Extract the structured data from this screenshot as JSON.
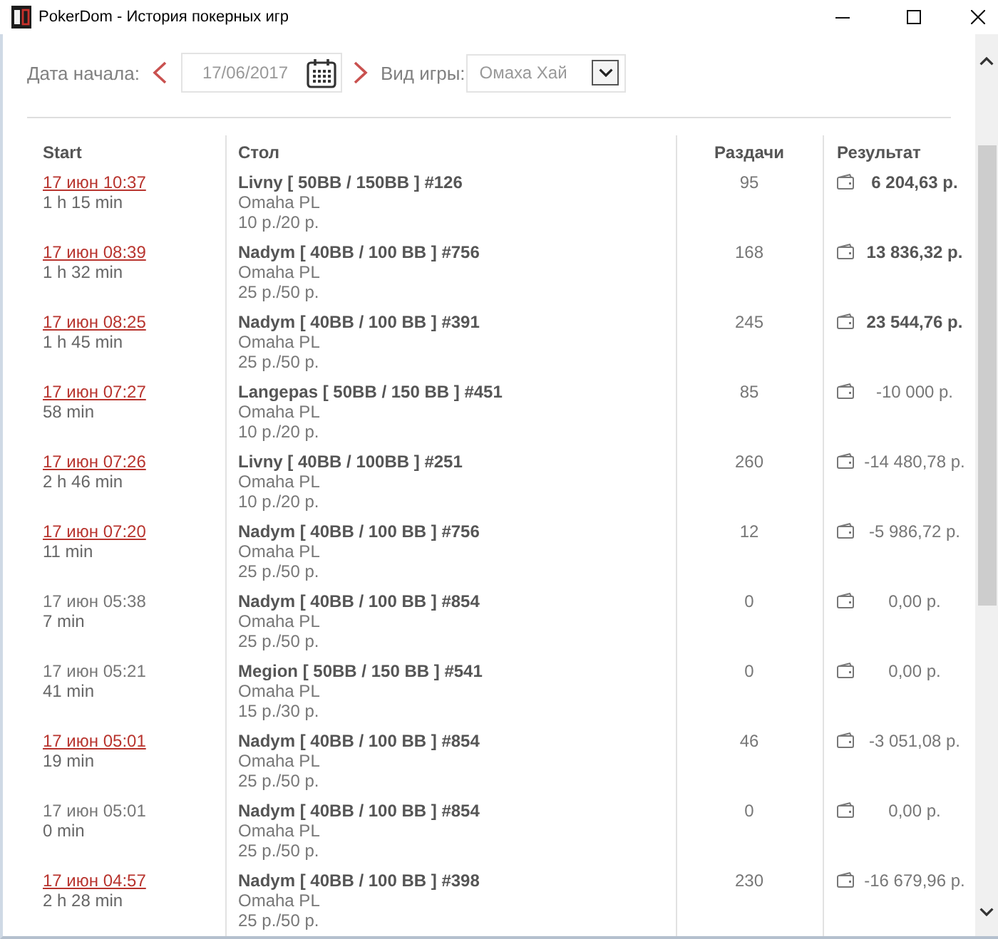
{
  "window": {
    "title": "PokerDom - История покерных игр"
  },
  "filters": {
    "date_label": "Дата начала:",
    "date": "17/06/2017",
    "game_label": "Вид игры:",
    "game": "Омаха Хай"
  },
  "table": {
    "columns": [
      "Start",
      "Стол",
      "Раздачи",
      "Результат"
    ],
    "rows": [
      {
        "start": "17 июн 10:37",
        "linked": true,
        "duration": "1 h 15 min",
        "table": "Livny [ 50BB / 150BB ] #126",
        "game": "Omaha PL",
        "stakes": "10 р./20 р.",
        "hands": "95",
        "result": "6 204,63 р.",
        "winning": true
      },
      {
        "start": "17 июн 08:39",
        "linked": true,
        "duration": "1 h 32 min",
        "table": "Nadym [ 40BB / 100 BB ] #756",
        "game": "Omaha PL",
        "stakes": "25 р./50 р.",
        "hands": "168",
        "result": "13 836,32 р.",
        "winning": true
      },
      {
        "start": "17 июн 08:25",
        "linked": true,
        "duration": "1 h 45 min",
        "table": "Nadym [ 40BB / 100 BB ] #391",
        "game": "Omaha PL",
        "stakes": "25 р./50 р.",
        "hands": "245",
        "result": "23 544,76 р.",
        "winning": true
      },
      {
        "start": "17 июн 07:27",
        "linked": true,
        "duration": "58 min",
        "table": "Langepas [ 50BB / 150 BB ] #451",
        "game": "Omaha PL",
        "stakes": "10 р./20 р.",
        "hands": "85",
        "result": "-10 000 р.",
        "winning": false
      },
      {
        "start": "17 июн 07:26",
        "linked": true,
        "duration": "2 h 46 min",
        "table": "Livny [ 40BB / 100BB ] #251",
        "game": "Omaha PL",
        "stakes": "10 р./20 р.",
        "hands": "260",
        "result": "-14 480,78 р.",
        "winning": false
      },
      {
        "start": "17 июн 07:20",
        "linked": true,
        "duration": "11 min",
        "table": "Nadym [ 40BB / 100 BB ] #756",
        "game": "Omaha PL",
        "stakes": "25 р./50 р.",
        "hands": "12",
        "result": "-5 986,72 р.",
        "winning": false
      },
      {
        "start": "17 июн 05:38",
        "linked": false,
        "duration": "7 min",
        "table": "Nadym [ 40BB / 100 BB ] #854",
        "game": "Omaha PL",
        "stakes": "25 р./50 р.",
        "hands": "0",
        "result": "0,00 р.",
        "winning": false
      },
      {
        "start": "17 июн 05:21",
        "linked": false,
        "duration": "41 min",
        "table": "Megion [ 50BB / 150 BB ] #541",
        "game": "Omaha PL",
        "stakes": "15 р./30 р.",
        "hands": "0",
        "result": "0,00 р.",
        "winning": false
      },
      {
        "start": "17 июн 05:01",
        "linked": true,
        "duration": "19 min",
        "table": "Nadym [ 40BB / 100 BB ] #854",
        "game": "Omaha PL",
        "stakes": "25 р./50 р.",
        "hands": "46",
        "result": "-3 051,08 р.",
        "winning": false
      },
      {
        "start": "17 июн 05:01",
        "linked": false,
        "duration": "0 min",
        "table": "Nadym [ 40BB / 100 BB ] #854",
        "game": "Omaha PL",
        "stakes": "25 р./50 р.",
        "hands": "0",
        "result": "0,00 р.",
        "winning": false
      },
      {
        "start": "17 июн 04:57",
        "linked": true,
        "duration": "2 h 28 min",
        "table": "Nadym [ 40BB / 100 BB ] #398",
        "game": "Omaha PL",
        "stakes": "25 р./50 р.",
        "hands": "230",
        "result": "-16 679,96 р.",
        "winning": false
      }
    ]
  }
}
